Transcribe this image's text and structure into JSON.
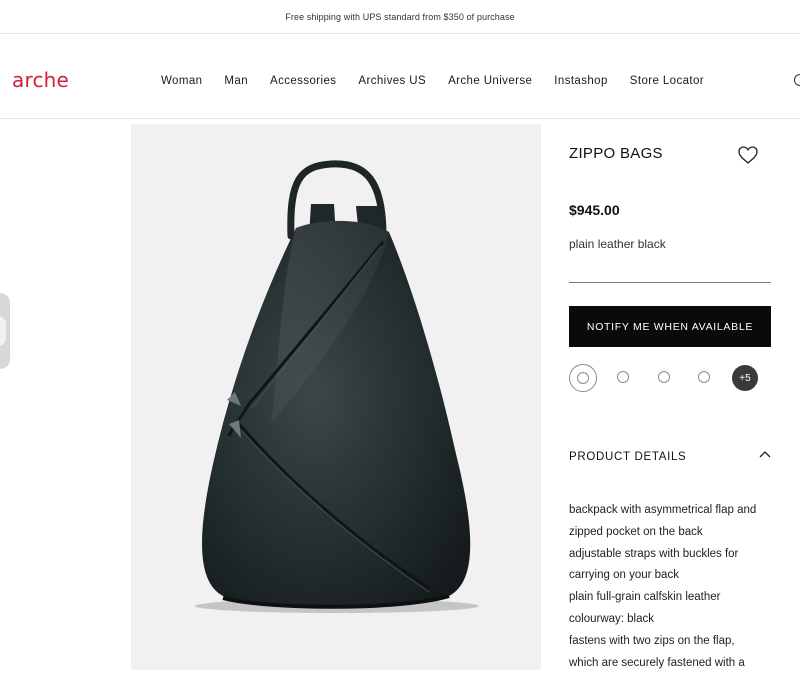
{
  "announcement": "Free shipping with UPS standard from $350 of purchase",
  "brand": {
    "logo_text": "arche",
    "color": "#d0203a"
  },
  "nav": {
    "items": [
      "Woman",
      "Man",
      "Accessories",
      "Archives US",
      "Arche Universe",
      "Instashop",
      "Store Locator"
    ]
  },
  "product": {
    "title": "ZIPPO BAGS",
    "price": "$945.00",
    "colour": "plain leather black",
    "notify_label": "NOTIFY ME WHEN AVAILABLE",
    "more_colors_label": "+5",
    "image_icon": "backpack-image"
  },
  "details": {
    "label": "PRODUCT DETAILS",
    "expanded": true,
    "lines": [
      "backpack with asymmetrical flap and",
      "zipped pocket on the back",
      "adjustable straps with buckles for",
      "carrying on your back",
      "plain full-grain calfskin leather",
      "colourway: black",
      "fastens with two zips on the flap,",
      "which are securely fastened with a"
    ]
  },
  "icons": {
    "wishlist": "heart-icon",
    "search": "search-icon",
    "chevron": "chevron-up-icon"
  }
}
